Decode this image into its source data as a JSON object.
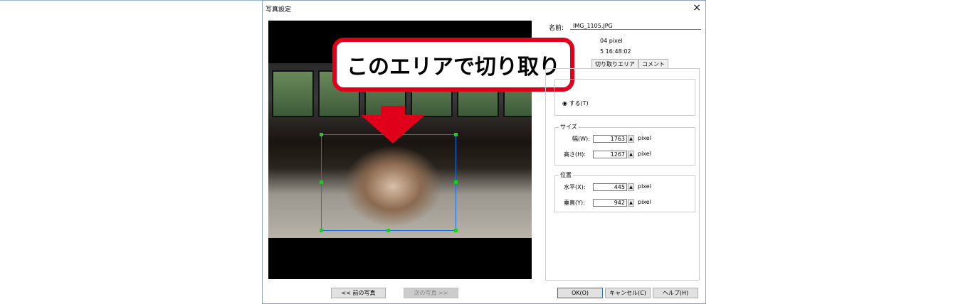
{
  "dialog": {
    "title": "写真設定",
    "close": "×"
  },
  "callout": "このエリアで切り取り",
  "info": {
    "name_label": "名前:",
    "name_value": "IMG_1105.JPG",
    "size_text": "04 pixel",
    "date_text": "5 16:48:02"
  },
  "tabs": [
    {
      "label": "切り取りエリア"
    },
    {
      "label": "コメント"
    }
  ],
  "crop": {
    "radio_label": "する(T)",
    "selected": true
  },
  "size": {
    "label": "サイズ",
    "width_label": "幅(W):",
    "width": "1763",
    "height_label": "高さ(H):",
    "height": "1267",
    "unit": "pixel"
  },
  "position": {
    "label": "位置",
    "x_label": "水平(X):",
    "x": "445",
    "y_label": "垂直(Y):",
    "y": "942",
    "unit": "pixel"
  },
  "buttons": {
    "prev": "<< 前の写真",
    "next": "次の写真 >>",
    "ok": "OK(O)",
    "cancel": "キャンセル(C)",
    "help": "ヘルプ(H)"
  },
  "colors": {
    "accent": "#1e6fe0",
    "callout": "#e0001a",
    "handle": "#19d019"
  }
}
